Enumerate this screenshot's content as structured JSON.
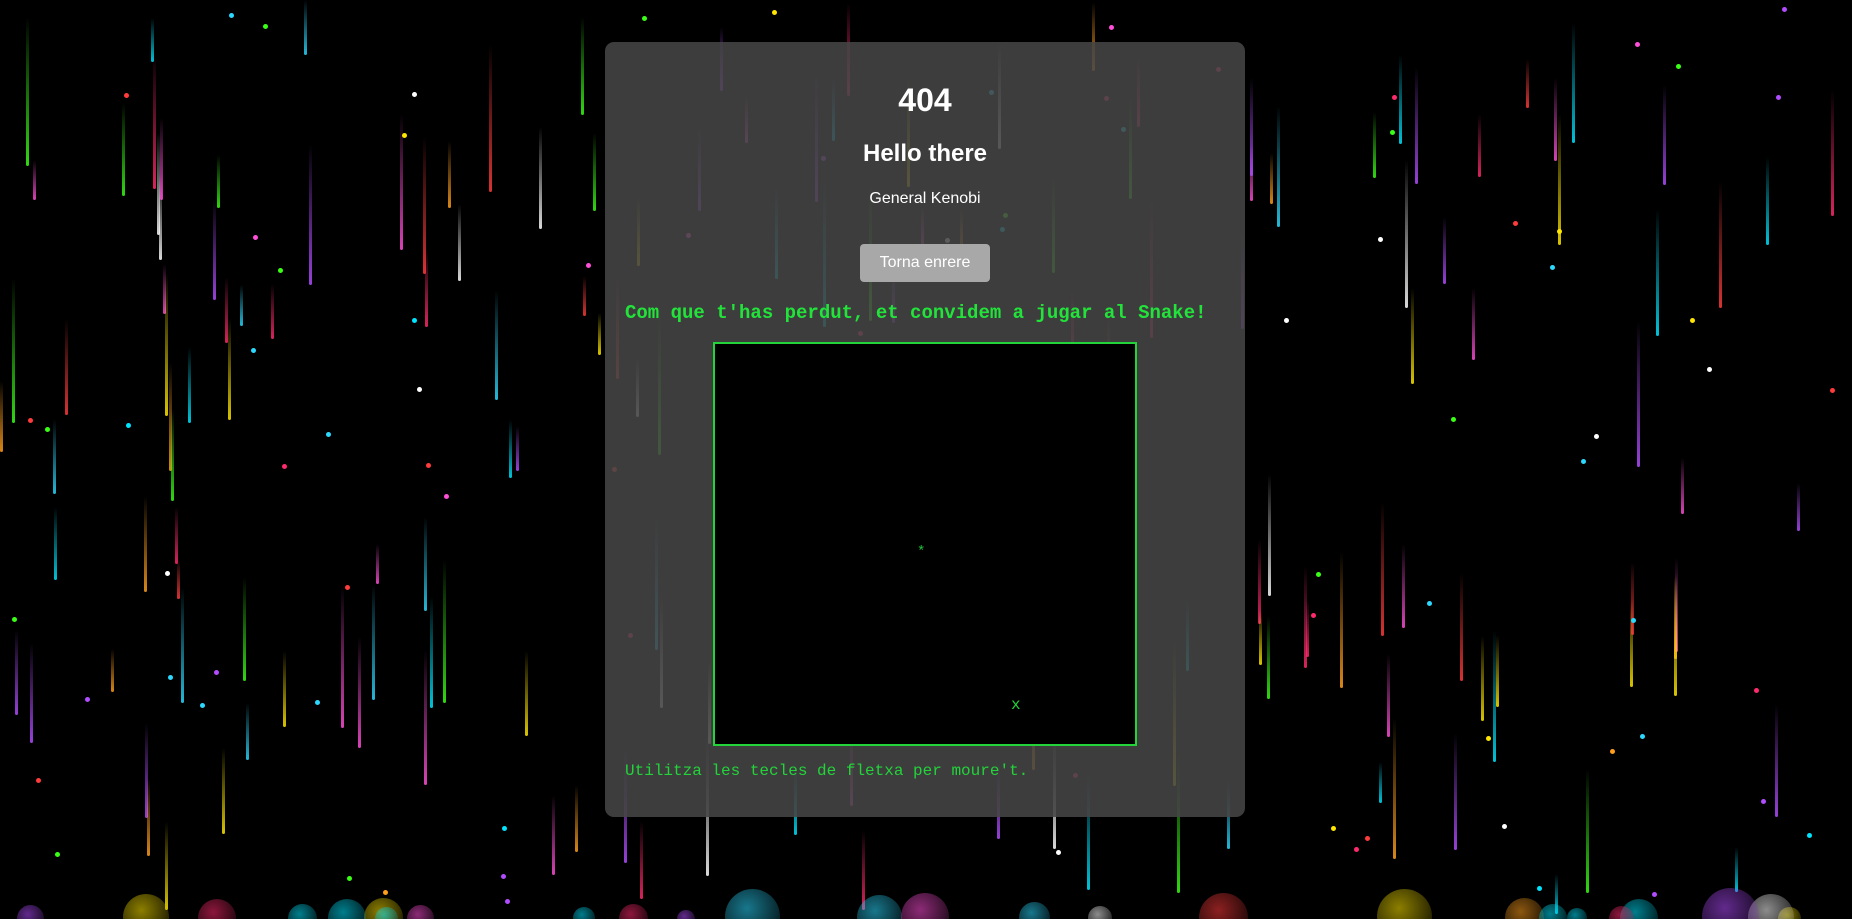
{
  "page": {
    "error_code": "404",
    "heading": "Hello there",
    "subheading": "General Kenobi",
    "back_button_label": "Torna enrere"
  },
  "game": {
    "invite_text": "Com que t'has perdut, et convidem a jugar al Snake!",
    "snake_glyph": "*",
    "food_glyph": "x",
    "instructions": "Utilitza les tecles de fletxa per moure't."
  },
  "colors": {
    "background": "#000000",
    "card": "#464646",
    "accent_green": "#22e33a",
    "button": "#a8a8a8"
  }
}
